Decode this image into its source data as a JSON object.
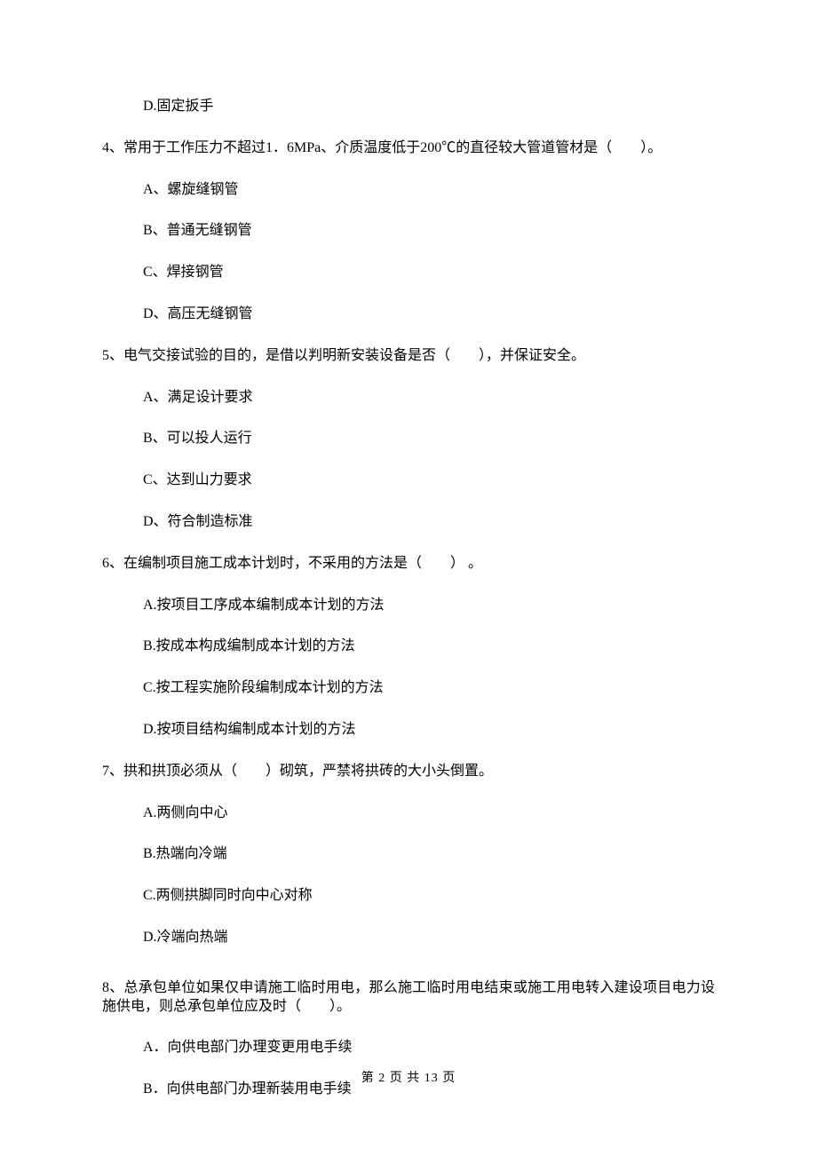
{
  "q3": {
    "optD": "D.固定扳手"
  },
  "q4": {
    "stem": "4、常用于工作压力不超过1．6MPa、介质温度低于200℃的直径较大管道管材是（　　）。",
    "optA": "A、螺旋缝钢管",
    "optB": "B、普通无缝钢管",
    "optC": "C、焊接钢管",
    "optD": "D、高压无缝钢管"
  },
  "q5": {
    "stem": "5、电气交接试验的目的，是借以判明新安装设备是否（　　），并保证安全。",
    "optA": "A、满足设计要求",
    "optB": "B、可以投人运行",
    "optC": "C、达到山力要求",
    "optD": "D、符合制造标准"
  },
  "q6": {
    "stem": "6、在编制项目施工成本计划时，不采用的方法是（　　） 。",
    "optA": "A.按项目工序成本编制成本计划的方法",
    "optB": "B.按成本构成编制成本计划的方法",
    "optC": "C.按工程实施阶段编制成本计划的方法",
    "optD": "D.按项目结构编制成本计划的方法"
  },
  "q7": {
    "stem": "7、拱和拱顶必须从（　　）砌筑，严禁将拱砖的大小头倒置。",
    "optA": "A.两侧向中心",
    "optB": "B.热端向冷端",
    "optC": "C.两侧拱脚同时向中心对称",
    "optD": "D.冷端向热端"
  },
  "q8": {
    "stem": "8、总承包单位如果仅申请施工临时用电，那么施工临时用电结束或施工用电转入建设项目电力设施供电，则总承包单位应及时（　　）。",
    "optA": "A．向供电部门办理变更用电手续",
    "optB": "B．向供电部门办理新装用电手续"
  },
  "footer": "第 2 页 共 13 页"
}
